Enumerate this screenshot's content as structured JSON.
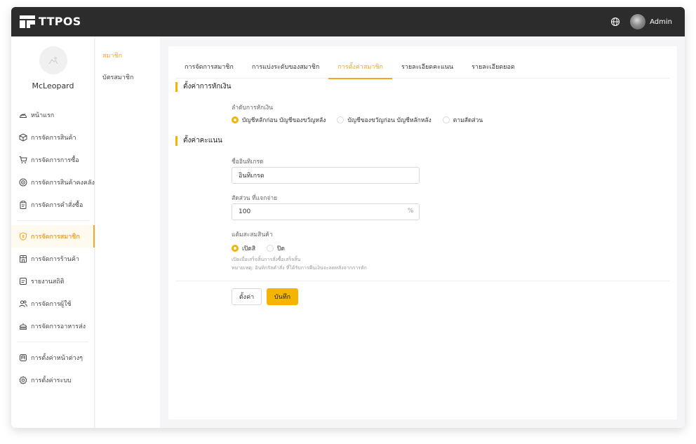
{
  "app": {
    "name": "TTPOS"
  },
  "header": {
    "user_name": "Admin"
  },
  "sidebar": {
    "username": "McLeopard",
    "items": [
      {
        "label": "หน้าแรก",
        "icon": "dashboard-icon"
      },
      {
        "label": "การจัดการสินค้า",
        "icon": "box-icon"
      },
      {
        "label": "การจัดการการซื้อ",
        "icon": "cart-icon"
      },
      {
        "label": "การจัดการสินค้าคงคลัง",
        "icon": "inventory-icon"
      },
      {
        "label": "การจัดการคำสั่งซื้อ",
        "icon": "clipboard-icon"
      },
      {
        "label": "การจัดการสมาชิก",
        "icon": "member-badge-icon",
        "active": true
      },
      {
        "label": "การจัดการร้านค้า",
        "icon": "store-icon"
      },
      {
        "label": "รายงานสถิติ",
        "icon": "report-icon"
      },
      {
        "label": "การจัดการผู้ใช้",
        "icon": "users-icon"
      },
      {
        "label": "การจัดการอาหารส่ง",
        "icon": "delivery-icon"
      },
      {
        "label": "การตั้งค่าหน้าต่างๆ",
        "icon": "page-settings-icon"
      },
      {
        "label": "การตั้งค่าระบบ",
        "icon": "gear-icon"
      }
    ]
  },
  "subnav": {
    "items": [
      {
        "label": "สมาชิก",
        "active": true
      },
      {
        "label": "บัตรสมาชิก",
        "active": false
      }
    ]
  },
  "tabs": [
    {
      "label": "การจัดการสมาชิก",
      "active": false
    },
    {
      "label": "การแบ่งระดับของสมาชิก",
      "active": false
    },
    {
      "label": "การตั้งค่าสมาชิก",
      "active": true
    },
    {
      "label": "รายละเอียดคะแนน",
      "active": false
    },
    {
      "label": "รายละเอียดยอด",
      "active": false
    }
  ],
  "deduction": {
    "section_title": "ตั้งค่าการหักเงิน",
    "order_label": "ลำดับการหักเงิน",
    "options": [
      {
        "label": "บัญชีหลักก่อน บัญชีของขวัญหลัง",
        "checked": true
      },
      {
        "label": "บัญชีของขวัญก่อน บัญชีหลักหลัง",
        "checked": false
      },
      {
        "label": "ตามสัดส่วน",
        "checked": false
      }
    ]
  },
  "points": {
    "section_title": "ตั้งค่าคะแนน",
    "name_label": "ชื่ออินทิเกรด",
    "name_value": "อินทิเกรด",
    "ratio_label": "สัดส่วน ที่แจกจ่าย",
    "ratio_value": "100",
    "ratio_suffix": "%",
    "accumulate_label": "แต้มสะสมสินค้า",
    "accumulate_options": [
      {
        "label": "เปิดสิ",
        "checked": true
      },
      {
        "label": "ปิด",
        "checked": false
      }
    ],
    "hint_line1": "เปิดเมื่อเสร็จสิ้นการสั่งซื้อเสร็จสิ้น",
    "hint_line2": "หมายเหตุ: อินทิกรัลคำสั่ง ที่ได้รับการคืนเงินจะลดหลังจากการหัก"
  },
  "actions": {
    "reset_label": "ตั้งค่า",
    "save_label": "บันทึก"
  },
  "colors": {
    "accent": "#f5b400",
    "active_text": "#f5a623",
    "topbar": "#2c2c2c"
  }
}
